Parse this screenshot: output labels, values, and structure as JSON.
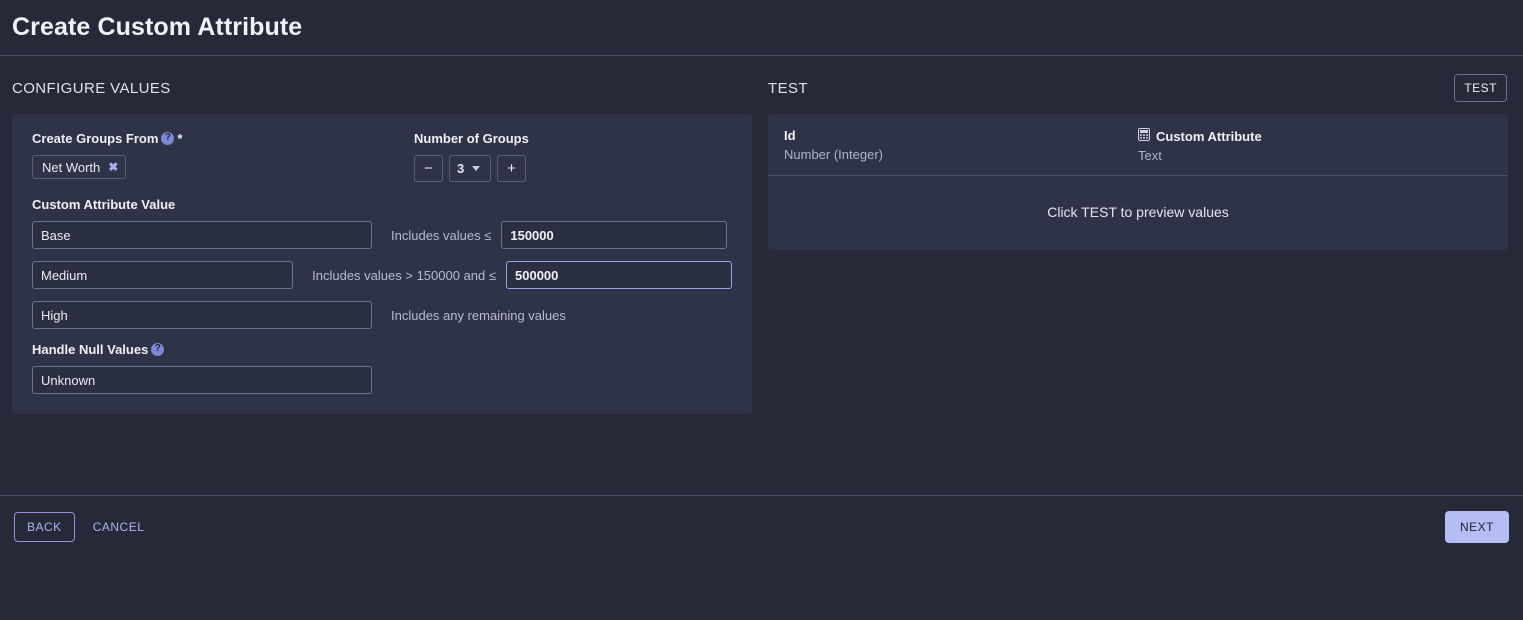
{
  "header": {
    "title": "Create Custom Attribute"
  },
  "configure": {
    "section_label": "CONFIGURE VALUES",
    "create_groups_from": {
      "label": "Create Groups From",
      "help_icon": "help-circle-icon",
      "required_marker": "*",
      "chip_label": "Net Worth",
      "chip_remove_icon": "close-icon"
    },
    "number_of_groups": {
      "label": "Number of Groups",
      "decrement_icon": "minus-icon",
      "increment_icon": "plus-icon",
      "value": "3",
      "caret_icon": "chevron-down-icon"
    },
    "custom_attribute_value": {
      "label": "Custom Attribute Value",
      "rows": [
        {
          "value": "Base",
          "rule_prefix": "Includes values ≤",
          "threshold": "150000",
          "has_threshold": true,
          "focused": false
        },
        {
          "value": "Medium",
          "rule_prefix": "Includes values > 150000 and ≤",
          "threshold": "500000",
          "has_threshold": true,
          "focused": true
        },
        {
          "value": "High",
          "rule_prefix": "Includes any remaining values",
          "threshold": "",
          "has_threshold": false,
          "focused": false
        }
      ]
    },
    "handle_null_values": {
      "label": "Handle Null Values",
      "help_icon": "help-circle-icon",
      "value": "Unknown"
    }
  },
  "test": {
    "section_label": "TEST",
    "test_button": "TEST",
    "columns": [
      {
        "name": "Id",
        "type": "Number (Integer)",
        "icon": ""
      },
      {
        "name": "Custom Attribute",
        "type": "Text",
        "icon": "calculator-icon"
      }
    ],
    "empty_message": "Click TEST to preview values"
  },
  "footer": {
    "back": "BACK",
    "cancel": "CANCEL",
    "next": "NEXT"
  },
  "colors": {
    "page_bg": "#262a38",
    "card_bg": "#2f3347",
    "accent": "#aeb4f2",
    "accent_filled": "#b6bdf5",
    "border": "#5a5f76",
    "focus_border": "#9aa1e8"
  }
}
